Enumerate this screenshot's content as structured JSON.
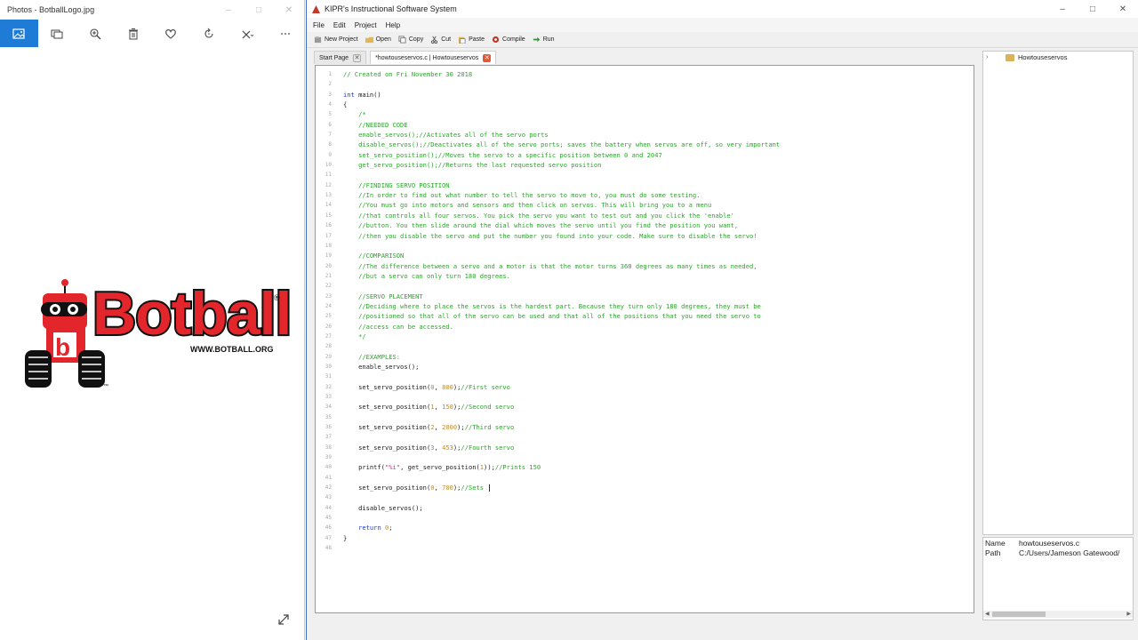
{
  "photos": {
    "title": "Photos - BotballLogo.jpg",
    "logo": {
      "brand_text": "Botball",
      "registered": "®",
      "url_text": "WWW.BOTBALL.ORG",
      "tm": "™",
      "colors": {
        "red": "#e3262b",
        "black": "#111111"
      }
    }
  },
  "kipr": {
    "title": "KIPR's Instructional Software System",
    "menu": [
      "File",
      "Edit",
      "Project",
      "Help"
    ],
    "toolbar": {
      "new_project": "New Project",
      "open": "Open",
      "copy": "Copy",
      "cut": "Cut",
      "paste": "Paste",
      "compile": "Compile",
      "run": "Run"
    },
    "tabs": [
      {
        "label": "Start Page"
      },
      {
        "label": "*howtouseservos.c | Howtouseservos"
      }
    ],
    "editor": {
      "lines": [
        {
          "n": "1",
          "code": "// Created on Fri November 30 2018"
        },
        {
          "n": "2",
          "code": ""
        },
        {
          "n": "3",
          "code": "int main()"
        },
        {
          "n": "4",
          "code": "{"
        },
        {
          "n": "5",
          "code": "    /*"
        },
        {
          "n": "6",
          "code": "    //NEEDED CODE"
        },
        {
          "n": "7",
          "code": "    enable_servos();//Activates all of the servo ports"
        },
        {
          "n": "8",
          "code": "    disable_servos();//Deactivates all of the servo ports; saves the battery when servos are off, so very important"
        },
        {
          "n": "9",
          "code": "    set_servo_position();//Moves the servo to a specific position between 0 and 2047"
        },
        {
          "n": "10",
          "code": "    get_servo_position();//Returns the last requested servo position"
        },
        {
          "n": "11",
          "code": ""
        },
        {
          "n": "12",
          "code": "    //FINDING SERVO POSITION"
        },
        {
          "n": "13",
          "code": "    //In order to find out what number to tell the servo to move to, you must do some testing."
        },
        {
          "n": "14",
          "code": "    //You must go into motors and sensors and then click on servos. This will bring you to a menu"
        },
        {
          "n": "15",
          "code": "    //that controls all four servos. You pick the servo you want to test out and you click the 'enable'"
        },
        {
          "n": "16",
          "code": "    //button. You then slide around the dial which moves the servo until you find the position you want,"
        },
        {
          "n": "17",
          "code": "    //then you disable the servo and put the number you found into your code. Make sure to disable the servo!"
        },
        {
          "n": "18",
          "code": ""
        },
        {
          "n": "19",
          "code": "    //COMPARISON"
        },
        {
          "n": "20",
          "code": "    //The difference between a servo and a motor is that the motor turns 360 degrees as many times as needed,"
        },
        {
          "n": "21",
          "code": "    //but a servo can only turn 180 degrees."
        },
        {
          "n": "22",
          "code": ""
        },
        {
          "n": "23",
          "code": "    //SERVO PLACEMENT"
        },
        {
          "n": "24",
          "code": "    //Deciding where to place the servos is the hardest part. Because they turn only 180 degrees, they must be"
        },
        {
          "n": "25",
          "code": "    //positioned so that all of the servo can be used and that all of the positions that you need the servo to"
        },
        {
          "n": "26",
          "code": "    //access can be accessed."
        },
        {
          "n": "27",
          "code": "    */"
        },
        {
          "n": "28",
          "code": ""
        },
        {
          "n": "29",
          "code": "    //EXAMPLES:"
        },
        {
          "n": "30",
          "code": "    enable_servos();"
        },
        {
          "n": "31",
          "code": ""
        },
        {
          "n": "32",
          "code": "    set_servo_position(0, 800);//First servo"
        },
        {
          "n": "33",
          "code": ""
        },
        {
          "n": "34",
          "code": "    set_servo_position(1, 150);//Second servo"
        },
        {
          "n": "35",
          "code": ""
        },
        {
          "n": "36",
          "code": "    set_servo_position(2, 2000);//Third servo"
        },
        {
          "n": "37",
          "code": ""
        },
        {
          "n": "38",
          "code": "    set_servo_position(3, 453);//Fourth servo"
        },
        {
          "n": "39",
          "code": ""
        },
        {
          "n": "40",
          "code": "    printf(\"%i\", get_servo_position(1));//Prints 150"
        },
        {
          "n": "41",
          "code": ""
        },
        {
          "n": "42",
          "code": "    set_servo_position(0, 700);//Sets "
        },
        {
          "n": "43",
          "code": ""
        },
        {
          "n": "44",
          "code": "    disable_servos();"
        },
        {
          "n": "45",
          "code": ""
        },
        {
          "n": "46",
          "code": "    return 0;"
        },
        {
          "n": "47",
          "code": "}"
        },
        {
          "n": "48",
          "code": ""
        }
      ]
    },
    "project_tree": {
      "item": "Howtouseservos"
    },
    "properties": {
      "name_key": "Name",
      "name_value": "howtouseservos.c",
      "path_key": "Path",
      "path_value": "C:/Users/Jameson Gatewood/"
    },
    "colors": {
      "comment": "#2aa52a",
      "keyword": "#1a3ad6",
      "number": "#c08a2a",
      "string": "#c83a8a",
      "close_tab": "#e05a3a"
    }
  }
}
